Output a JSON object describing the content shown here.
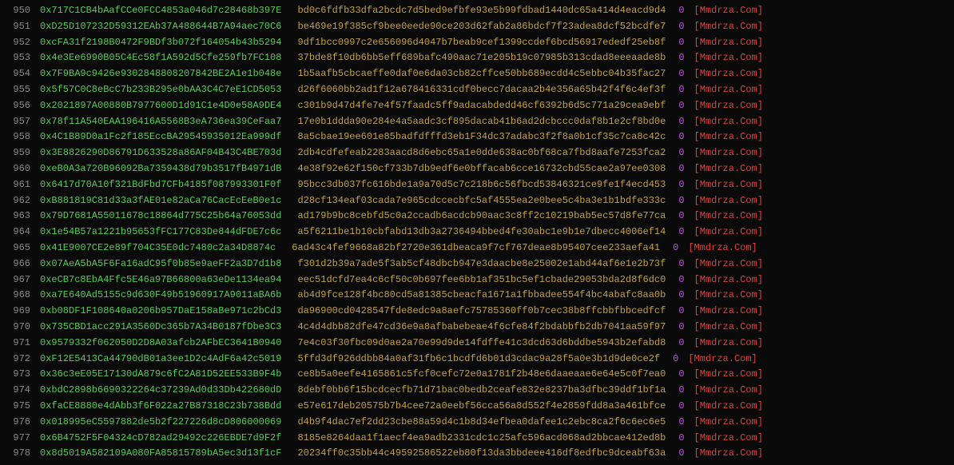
{
  "rows": [
    {
      "line": "950",
      "hex": "0x717C1CB4bAafCCe0FCC4853a046d7c28468b397E",
      "hash": "bd0c6fdfb33dfa2bcdc7d5bed9efbfe93e5b99fdbad1440dc65a414d4eacd9d4",
      "zero": "0",
      "src": "[Mmdrza.Com]"
    },
    {
      "line": "951",
      "hex": "0xD25D107232D59312EAb37A488644B7A94aec70C6",
      "hash": "be469e19f385cf9bee0eede90ce203d62fab2a86bdcf7f23adea8dcf52bcdfe7",
      "zero": "0",
      "src": "[Mmdrza.Com]"
    },
    {
      "line": "952",
      "hex": "0xcFA31f2198B0472F9BDf3b072f164054b43b5294",
      "hash": "9df1bcc0997c2e656096d4047b7beab9cef1399ccdef6bcd56917ededf25eb8f",
      "zero": "0",
      "src": "[Mmdrza.Com]"
    },
    {
      "line": "953",
      "hex": "0x4e3Ee6990B05C4Ec58f1A592d5Cfe259fb7FC108",
      "hash": "37bde8f10db6bb5eff689bafc490aac71e205b19c07985b313cdad8eeeaade8b",
      "zero": "0",
      "src": "[Mmdrza.Com]"
    },
    {
      "line": "954",
      "hex": "0x7F9BA9c9426e9302848808207842BE2A1e1b048e",
      "hash": "1b5aafb5cbcaeffe0daf0e6da03cb82cffce50bb689ecdd4c5ebbc04b35fac27",
      "zero": "0",
      "src": "[Mmdrza.Com]"
    },
    {
      "line": "955",
      "hex": "0x5f57C0C8eBcC7b233B295e0bAA3C4C7eE1CD5053",
      "hash": "d26f6060bb2ad1f12a678416331cdf0becc7dacaa2b4e356a65b42f4f6c4ef3f",
      "zero": "0",
      "src": "[Mmdrza.Com]"
    },
    {
      "line": "956",
      "hex": "0x2021897A00880B7977600D1d91C1e4D0e58A9DE4",
      "hash": "c301b9d47d4fe7e4f57faadc5ff9adacabdedd46cf6392b6d5c771a29cea9ebf",
      "zero": "0",
      "src": "[Mmdrza.Com]"
    },
    {
      "line": "957",
      "hex": "0x78f11A540EAA196416A5568B3eA736ea39CeFaa7",
      "hash": "17e0b1ddda90e284e4a5aadc3cf895dacab41b6ad2dcbccc0daf8b1e2cf8bd0e",
      "zero": "0",
      "src": "[Mmdrza.Com]"
    },
    {
      "line": "958",
      "hex": "0x4C1B89D0a1Fc2f185EccBA29545935012Ea999df",
      "hash": "8a5cbae19ee601e85badfdfffd3eb1F34dc37adabc3f2f8a0b1cf35c7ca8c42c",
      "zero": "0",
      "src": "[Mmdrza.Com]"
    },
    {
      "line": "959",
      "hex": "0x3E8826290D86791D633528a86AF04B43C4BE703d",
      "hash": "2db4cdfefeab2283aacd8d6ebc65a1e0dde638ac0bf68ca7fbd8aafe7253fca2",
      "zero": "0",
      "src": "[Mmdrza.Com]"
    },
    {
      "line": "960",
      "hex": "0xeB0A3a720B96092Ba7359438d79b3517fB4971dB",
      "hash": "4e38f92e62f150cf733b7db9edf6e0bffacab6cce16732cbd55cae2a97ee0308",
      "zero": "0",
      "src": "[Mmdrza.Com]"
    },
    {
      "line": "961",
      "hex": "0x6417d70A10f321BdFbd7CFb4185f087993301F0f",
      "hash": "95bcc3db037fc616bde1a9a70d5c7c218b6c56fbcd53846321ce9fe1f4ecd453",
      "zero": "0",
      "src": "[Mmdrza.Com]"
    },
    {
      "line": "962",
      "hex": "0xB881819C81d33a3fAE01e82aCa76CacEcEeB0e1c",
      "hash": "d28cf134eaf03cada7e965cdccecbfc5af4555ea2e0bee5c4ba3e1b1bdfe333c",
      "zero": "0",
      "src": "[Mmdrza.Com]"
    },
    {
      "line": "963",
      "hex": "0x79D7681A55011678c18864d775C25b64a76053dd",
      "hash": "ad179b9bc8cebfd5c0a2ccadb6acdcb90aac3c8ff2c10219bab5ec57d8fe77ca",
      "zero": "0",
      "src": "[Mmdrza.Com]"
    },
    {
      "line": "964",
      "hex": "0x1e54B57a1221b95653fFC177C83De844dFDE7c6c",
      "hash": "a5f6211be1b10cbfabd13db3a2736494bbed4fe30abc1e9b1e7dbecc4006ef14",
      "zero": "0",
      "src": "[Mmdrza.Com]"
    },
    {
      "line": "965",
      "hex": "0x41E9007CE2e89f704C35E0dc7480c2a34D8874c",
      "hash": "6ad43c4fef9668a82bf2720e361dbeaca9f7cf767deae8b95407cee233aefa41",
      "zero": "0",
      "src": "[Mmdrza.Com]"
    },
    {
      "line": "966",
      "hex": "0x07AeA5bA5F6Fa16adC95f0b85e9aeFF2a3D7d1b8",
      "hash": "f301d2b39a7ade5f3ab5cf48dbcb947e3daacbe8e25002e1abd44af6e1e2b73f",
      "zero": "0",
      "src": "[Mmdrza.Com]"
    },
    {
      "line": "967",
      "hex": "0xeCB7c8EbA4Ffc5E46a97B66800a63eDe1134ea94",
      "hash": "eec51dcfd7ea4c6cf50c0b697fee6bb1af351bc5ef1cbade29053bda2d8f6dc0",
      "zero": "0",
      "src": "[Mmdrza.Com]"
    },
    {
      "line": "968",
      "hex": "0xa7E640Ad5155c9d630F49b51960917A9011aBA6b",
      "hash": "ab4d9fce128f4bc80cd5a81385cbeacfa1671a1fbbadee554f4bc4abafc8aa0b",
      "zero": "0",
      "src": "[Mmdrza.Com]"
    },
    {
      "line": "969",
      "hex": "0xb08DF1F108640a0206b957DaE158aBe971c2bCd3",
      "hash": "da96900cd0428547fde8edc9a8aefc75785360ff0b7cec38b8ffcbbfbbcedfcf",
      "zero": "0",
      "src": "[Mmdrza.Com]"
    },
    {
      "line": "970",
      "hex": "0x735CBD1acc291A3560Dc365b7A34B0187fDbe3C3",
      "hash": "4c4d4dbb82dfe47cd36e9a8afbabebeae4f6cfe84f2bdabbfb2db7041aa59f97",
      "zero": "0",
      "src": "[Mmdrza.Com]"
    },
    {
      "line": "971",
      "hex": "0x9579332f062050D2D8A03afcb2AFbEC3641B0940",
      "hash": "7e4c03f30fbc09d0ae2a70e99d9de14fdffe41c3dcd63d6bddbe5943b2efabd8",
      "zero": "0",
      "src": "[Mmdrza.Com]"
    },
    {
      "line": "972",
      "hex": "0xF12E5413Ca44790dB01a3ee1D2c4AdF6a42c5019",
      "hash": "5ffd3df926ddbb84a0af31fb6c1bcdfd6b01d3cdac9a28f5a0e3b1d9de0ce2f",
      "zero": "0",
      "src": "[Mmdrza.Com]"
    },
    {
      "line": "973",
      "hex": "0x36c3eE05E17130dA879c6fC2A81D52EE533B9F4b",
      "hash": "ce8b5a0eefe4165861c5fcf0cefc72e0a1781f2b48e6daaeaae6e64e5c0f7ea0",
      "zero": "0",
      "src": "[Mmdrza.Com]"
    },
    {
      "line": "974",
      "hex": "0xbdC2898b6690322264c37239Ad0d33Db422680dD",
      "hash": "8debf0bb6f15bcdcecfb71d71bac0bedb2ceafe832e8237ba3dfbc39ddf1bf1a",
      "zero": "0",
      "src": "[Mmdrza.Com]"
    },
    {
      "line": "975",
      "hex": "0xfaCE8880e4dAbb3f6F022a27B87318C23b738Bdd",
      "hash": "e57e617deb20575b7b4cee72a0eebf56cca56a8d552f4e2859fdd8a3a461bfce",
      "zero": "0",
      "src": "[Mmdrza.Com]"
    },
    {
      "line": "976",
      "hex": "0x018995eC5597882de5b2f227226d8cD806000069",
      "hash": "d4b9f4dac7ef2dd23cbe88a59d4c1b8d34efbea0dafee1c2ebc8ca2f6c6ec6e5",
      "zero": "0",
      "src": "[Mmdrza.Com]"
    },
    {
      "line": "977",
      "hex": "0x6B4752F5F04324cD782ad29492c226EBDE7d9F2f",
      "hash": "8185e8264daa1f1aecf4ea9adb2331cdc1c25afc596acd068ad2bbcae412ed8b",
      "zero": "0",
      "src": "[Mmdrza.Com]"
    },
    {
      "line": "978",
      "hex": "0x8d5019A582109A080FA85815789bA5ec3d13f1cF",
      "hash": "20234ff0c35bb44c49592586522eb80f13da3bbdeee416df8edfbc9dceabf63a",
      "zero": "0",
      "src": "[Mmdrza.Com]"
    }
  ]
}
